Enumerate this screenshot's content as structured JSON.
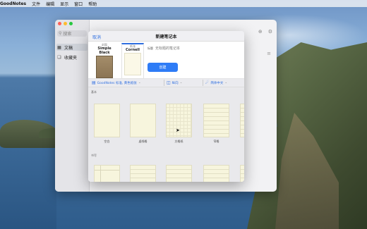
{
  "menubar": {
    "app": "GoodNotes",
    "items": [
      "文件",
      "编辑",
      "显示",
      "窗口",
      "帮助"
    ]
  },
  "sidebar": {
    "search_placeholder": "搜索",
    "items": [
      {
        "label": "文稿",
        "icon": "grid-icon",
        "active": true
      },
      {
        "label": "收藏夹",
        "icon": "bookmark-icon",
        "active": false
      }
    ]
  },
  "modal": {
    "cancel_label": "取消",
    "title": "新建笔记本",
    "covers": [
      {
        "caption": "封面",
        "name": "Simple Black",
        "selected": false
      },
      {
        "caption": "纸张",
        "name": "Cornell",
        "selected": true
      }
    ],
    "name_label": "标题",
    "name_placeholder": "无标题的笔记本",
    "create_label": "创建",
    "toolbar": {
      "template_set": "GoodNotes 标准, 黄色纸张",
      "orientation": "纵向",
      "language": "简体中文"
    },
    "section_basic": "基本",
    "section_writing": "书写",
    "basic_templates": [
      {
        "label": "空白",
        "style": "blank"
      },
      {
        "label": "虚线格",
        "style": "blank"
      },
      {
        "label": "方格纸",
        "style": "grid"
      },
      {
        "label": "窄格",
        "style": "ruled"
      }
    ]
  },
  "colors": {
    "accent": "#2e7cf6",
    "paper": "#f7f5dd",
    "window_bg": "#f2f2f4"
  }
}
